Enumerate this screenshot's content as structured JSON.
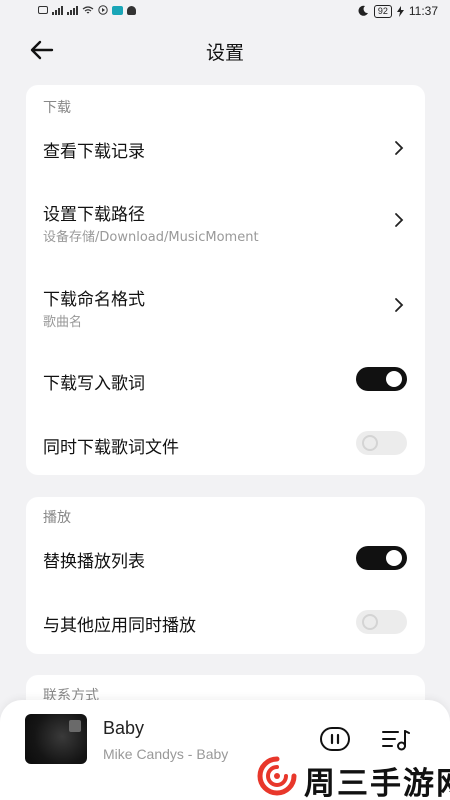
{
  "status_bar": {
    "left_icons": [
      "dual-sim-icon",
      "signal-4g-icon",
      "signal-4g-icon",
      "wifi-icon",
      "play-icon",
      "app-icon",
      "ghost-icon"
    ],
    "moon_icon": "moon-icon",
    "battery": "92",
    "time": "11:37"
  },
  "header": {
    "title": "设置",
    "back_icon": "back-arrow-icon"
  },
  "download_section": {
    "label": "下载",
    "rows": [
      {
        "title": "查看下载记录",
        "subtitle": "",
        "control": "chevron"
      },
      {
        "title": "设置下载路径",
        "subtitle": "设备存储/Download/MusicMoment",
        "control": "chevron"
      },
      {
        "title": "下载命名格式",
        "subtitle": "歌曲名",
        "control": "chevron"
      },
      {
        "title": "下载写入歌词",
        "subtitle": "",
        "control": "toggle",
        "on": true
      },
      {
        "title": "同时下载歌词文件",
        "subtitle": "",
        "control": "toggle",
        "on": false
      }
    ]
  },
  "playback_section": {
    "label": "播放",
    "rows": [
      {
        "title": "替换播放列表",
        "control": "toggle",
        "on": true
      },
      {
        "title": "与其他应用同时播放",
        "control": "toggle",
        "on": false
      }
    ]
  },
  "contact_section": {
    "label": "联系方式"
  },
  "player": {
    "song": "Baby",
    "artist": "Mike Candys - Baby",
    "play_icon": "pause-play-icon",
    "playlist_icon": "playlist-icon"
  },
  "watermark": {
    "text": "周三手游网"
  },
  "colors": {
    "background": "#f2f2f4",
    "toggle_on": "#111111",
    "toggle_off": "#ececec",
    "watermark_logo": "#e8372b"
  }
}
